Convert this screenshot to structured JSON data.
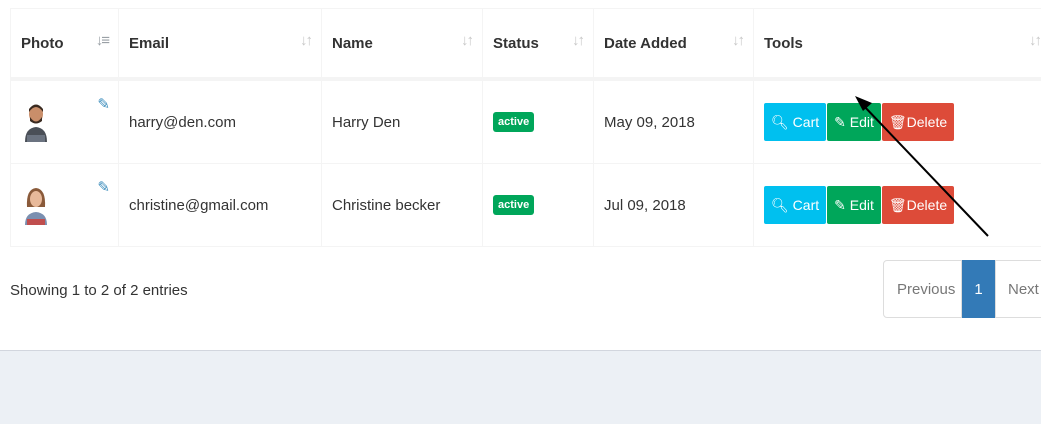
{
  "table": {
    "columns": [
      "Photo",
      "Email",
      "Name",
      "Status",
      "Date Added",
      "Tools"
    ],
    "rows": [
      {
        "email": "harry@den.com",
        "name": "Harry Den",
        "status": "active",
        "date_added": "May 09, 2018"
      },
      {
        "email": "christine@gmail.com",
        "name": "Christine becker",
        "status": "active",
        "date_added": "Jul 09, 2018"
      }
    ],
    "buttons": {
      "cart": "Cart",
      "edit": "Edit",
      "delete": "Delete"
    }
  },
  "footer": {
    "info": "Showing 1 to 2 of 2 entries",
    "pagination": {
      "previous": "Previous",
      "current": "1",
      "next": "Next"
    }
  },
  "colors": {
    "cart": "#00c0ef",
    "edit": "#00a65a",
    "delete": "#dd4b39",
    "badge": "#00a65a",
    "page_active": "#337ab7"
  }
}
